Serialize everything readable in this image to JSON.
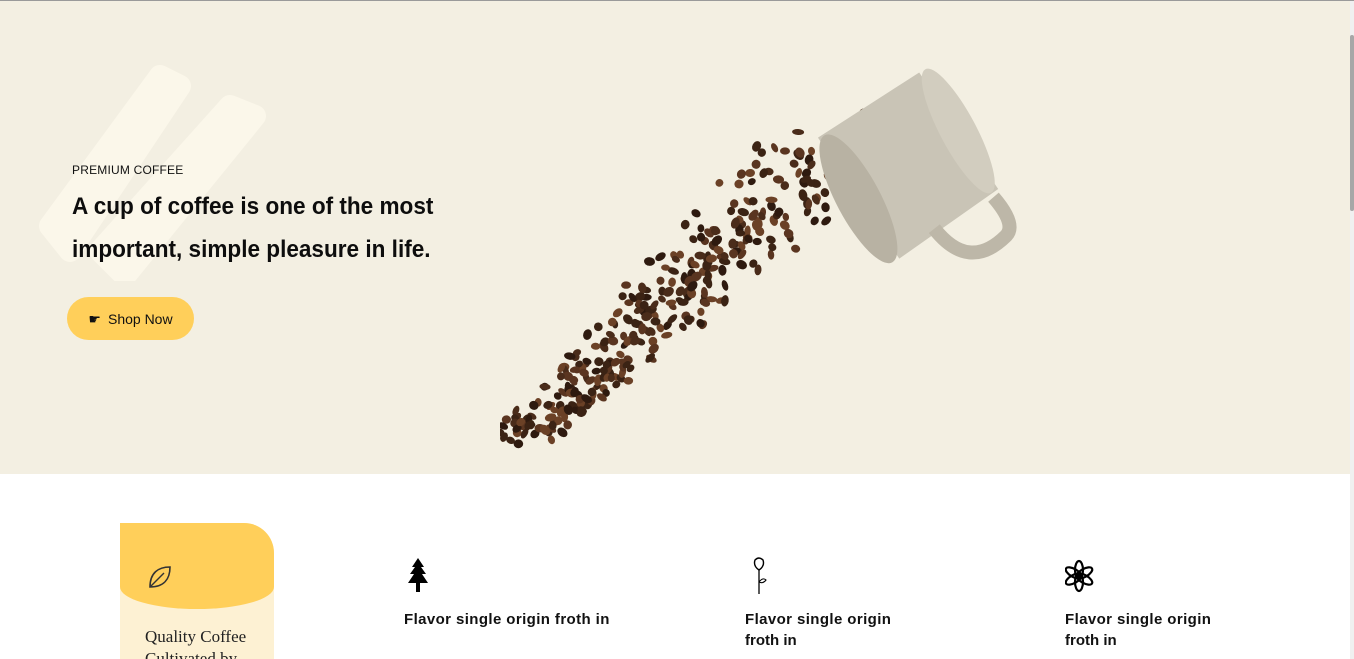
{
  "hero": {
    "eyebrow": "PREMIUM COFFEE",
    "title": "A cup of coffee is one of the most important, simple pleasure in life.",
    "cta_label": "Shop Now",
    "cta_icon": "hand-pointing-right-icon",
    "background": "#f3efe2"
  },
  "colors": {
    "accent": "#ffcf5a",
    "accent_light": "#fdf1d3"
  },
  "features": {
    "quality_card": {
      "icon": "leaf-icon",
      "text": "Quality Coffee Cultivated by"
    },
    "items": [
      {
        "icon": "tree-icon",
        "title": "Flavor single origin froth in",
        "subtitle": ""
      },
      {
        "icon": "rose-icon",
        "title": "Flavor single origin",
        "subtitle": "froth in"
      },
      {
        "icon": "flower-icon",
        "title": "Flavor single origin",
        "subtitle": "froth in"
      }
    ]
  }
}
